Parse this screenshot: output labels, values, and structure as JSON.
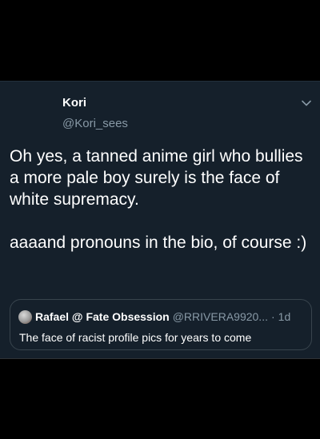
{
  "tweet": {
    "display_name": "Kori",
    "handle": "@Kori_sees",
    "text_paragraph_1": "Oh yes, a tanned anime girl who bullies a more pale boy surely is the face of white supremacy.",
    "text_paragraph_2": "aaaand pronouns in the bio, of course :)",
    "menu_icon": "chevron-down-icon"
  },
  "quoted_tweet": {
    "display_name": "Rafael @ Fate Obsession",
    "handle": "@RRIVERA9920...",
    "separator": "·",
    "time": "1d",
    "text": "The face of racist profile pics for years to come"
  },
  "colors": {
    "background": "#000000",
    "card": "#15202b",
    "secondary_text": "#8899a6",
    "border": "#38444d"
  }
}
